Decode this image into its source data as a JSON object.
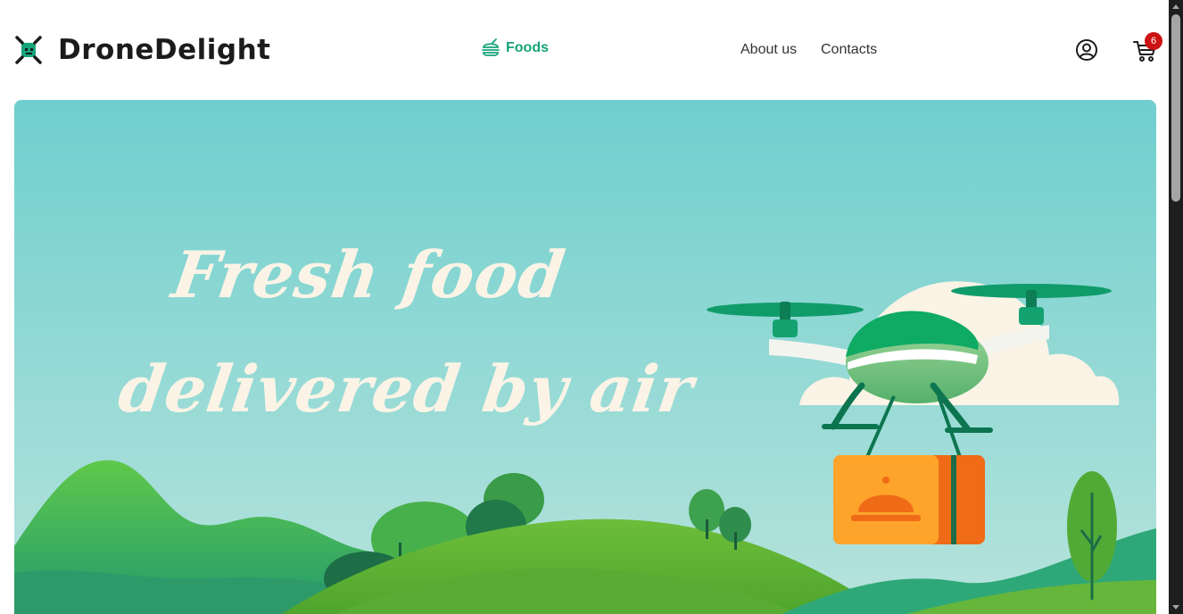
{
  "brand": {
    "name": "DroneDelight",
    "logo_icon": "drone-icon"
  },
  "nav": {
    "foods": {
      "label": "Foods",
      "icon": "burger-icon",
      "active": true
    },
    "about_label": "About us",
    "contacts_label": "Contacts"
  },
  "header": {
    "user_icon": "user-icon",
    "cart_icon": "cart-icon",
    "cart_count": "6"
  },
  "hero": {
    "line1": "Fresh food",
    "line2": "delivered by air"
  },
  "colors": {
    "accent": "#17a47a",
    "badge": "#cc1212",
    "hero_text": "#fbf4e6",
    "sky_top": "#6fcfce",
    "sky_bottom": "#b3e2dc",
    "box": "#ffa42b"
  }
}
